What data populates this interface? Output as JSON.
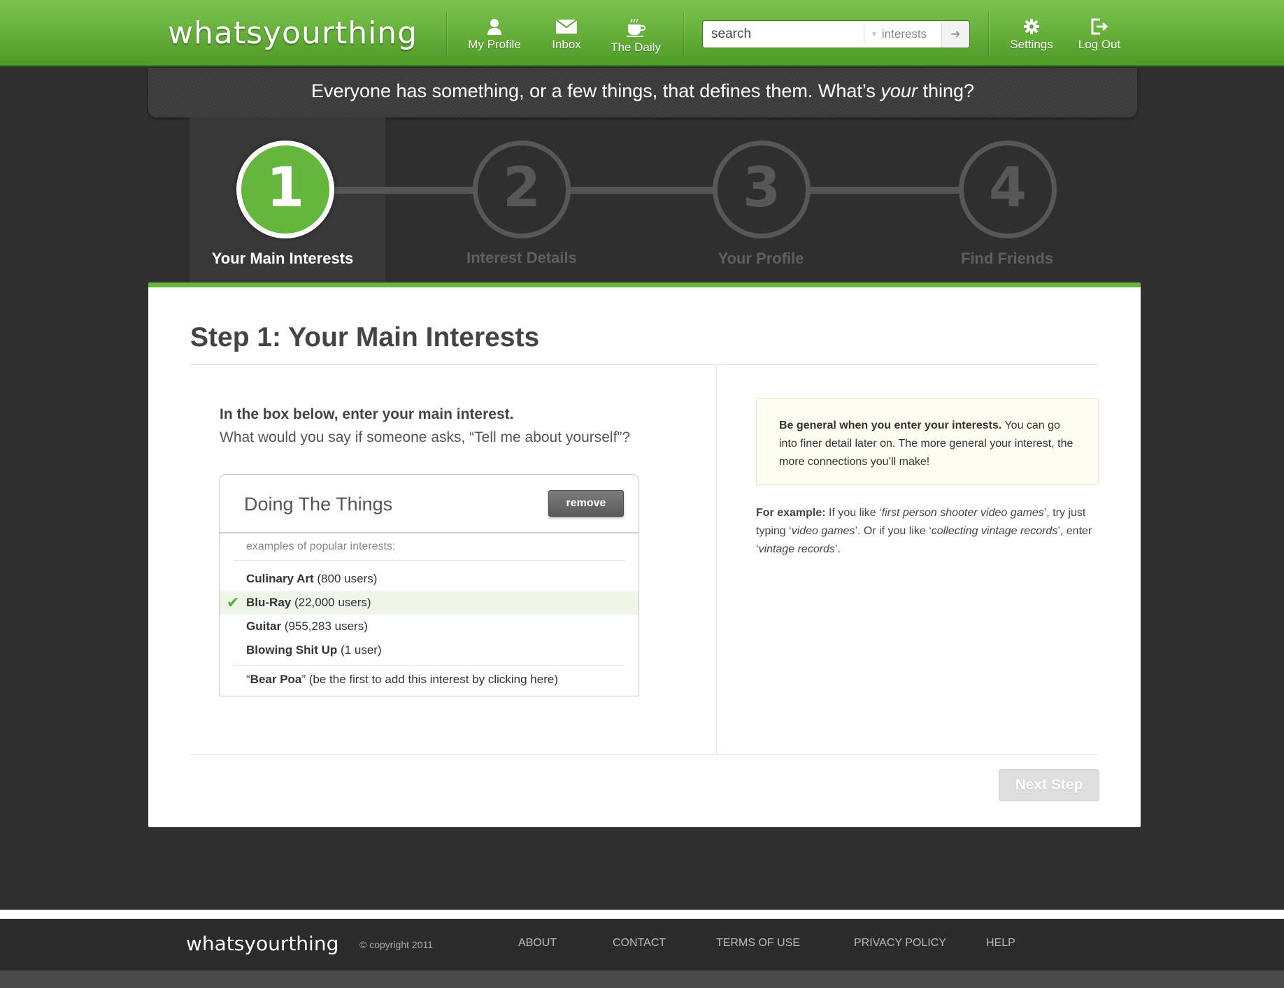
{
  "header": {
    "logo": "whatsyourthing",
    "nav": [
      {
        "label": "My Profile",
        "icon": "person-icon"
      },
      {
        "label": "Inbox",
        "icon": "envelope-icon"
      },
      {
        "label": "The Daily",
        "icon": "coffee-cup-icon"
      }
    ],
    "search": {
      "placeholder": "search",
      "filter": "interests"
    },
    "right_nav": [
      {
        "label": "Settings",
        "icon": "gear-icon"
      },
      {
        "label": "Log Out",
        "icon": "logout-icon"
      }
    ]
  },
  "banner": {
    "tagline_start": "Everyone has something, or a few things, that defines them. What’s ",
    "tagline_em": "your",
    "tagline_end": " thing?"
  },
  "steps": [
    {
      "number": "1",
      "label": "Your Main Interests",
      "active": true
    },
    {
      "number": "2",
      "label": "Interest Details",
      "active": false
    },
    {
      "number": "3",
      "label": "Your Profile",
      "active": false
    },
    {
      "number": "4",
      "label": "Find Friends",
      "active": false
    }
  ],
  "main": {
    "title": "Step 1: Your Main Interests",
    "prompt_bold": "In the box below, enter your main interest.",
    "prompt_text": "What would you say if someone asks, “Tell me about yourself”?",
    "interest_value": "Doing The Things",
    "remove_label": "remove",
    "examples_label": "examples of popular interests:",
    "suggestions": [
      {
        "name": "Culinary Art",
        "count": " (800 users)",
        "selected": false
      },
      {
        "name": "Blu-Ray",
        "count": " (22,000 users)",
        "selected": true
      },
      {
        "name": "Guitar",
        "count": " (955,283 users)",
        "selected": false
      },
      {
        "name": "Blowing Shit Up",
        "count": " (1 user)",
        "selected": false
      }
    ],
    "add_new": {
      "quote_open": "“",
      "name": "Bear Poa",
      "rest": "” (be the first to add this interest by clicking here)"
    },
    "tip_bold": "Be general when you enter your interests.",
    "tip_text": " You can go into finer detail later on. The more general your interest, the more connections you’ll make!",
    "example": {
      "label": "For example:",
      "p1": " If you like ‘",
      "i1": "first person shooter video games",
      "p2": "’, try just typing ‘",
      "i2": "video games",
      "p3": "’. Or if you like ‘",
      "i3": "collecting vintage records",
      "p4": "’, enter ‘",
      "i4": "vintage records",
      "p5": "’."
    },
    "next_label": "Next Step"
  },
  "footer": {
    "logo": "whatsyourthing",
    "copyright": "© copyright 2011",
    "links": [
      "ABOUT",
      "CONTACT",
      "TERMS OF USE",
      "PRIVACY POLICY",
      "HELP"
    ]
  },
  "colors": {
    "brand_green": "#64b63c",
    "dark_bg": "#2f2f2f"
  }
}
